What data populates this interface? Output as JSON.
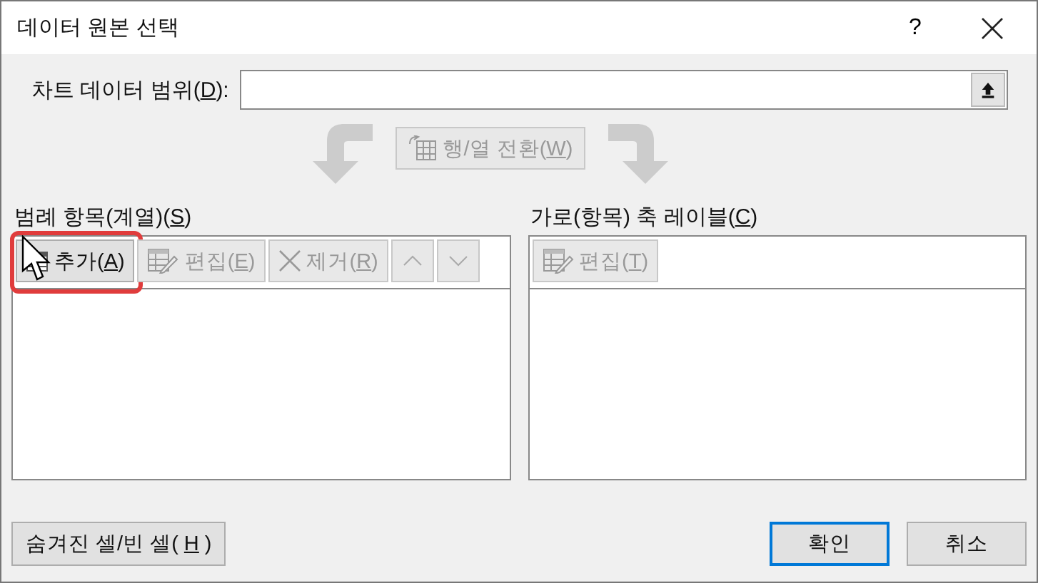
{
  "window": {
    "title": "데이터 원본 선택",
    "help": "?"
  },
  "range": {
    "label": {
      "pre": "차트 데이터 범위(",
      "key": "D",
      "post": "):"
    }
  },
  "switch_button": {
    "label": {
      "pre": "행/열 전환(",
      "key": "W",
      "post": ")"
    },
    "disabled": true
  },
  "series": {
    "label": {
      "pre": "범례 항목(계열)(",
      "key": "S",
      "post": ")"
    },
    "toolbar": [
      {
        "kind": "add",
        "label": {
          "pre": "추가(",
          "key": "A",
          "post": ")"
        },
        "disabled": false,
        "highlighted": true,
        "pointer": true
      },
      {
        "kind": "edit",
        "label": {
          "pre": "편집(",
          "key": "E",
          "post": ")"
        },
        "disabled": true,
        "highlighted": false,
        "pointer": false
      },
      {
        "kind": "remove",
        "label": {
          "pre": "제거(",
          "key": "R",
          "post": ")"
        },
        "disabled": true,
        "highlighted": false,
        "pointer": false
      },
      {
        "kind": "up",
        "disabled": true,
        "highlighted": false,
        "pointer": false
      },
      {
        "kind": "down",
        "disabled": true,
        "highlighted": false,
        "pointer": false
      }
    ]
  },
  "categories": {
    "label": {
      "pre": "가로(항목) 축 레이블(",
      "key": "C",
      "post": ")"
    },
    "toolbar": [
      {
        "kind": "edit",
        "label": {
          "pre": "편집(",
          "key": "T",
          "post": ")"
        },
        "disabled": true,
        "highlighted": false,
        "pointer": false
      }
    ]
  },
  "footer": {
    "hidden_cells": {
      "pre": "숨겨진 셀/빈 셀(",
      "key": "H",
      "post": ")"
    },
    "buttons": [
      {
        "label": "확인",
        "default": true
      },
      {
        "label": "취소",
        "default": false
      }
    ]
  }
}
